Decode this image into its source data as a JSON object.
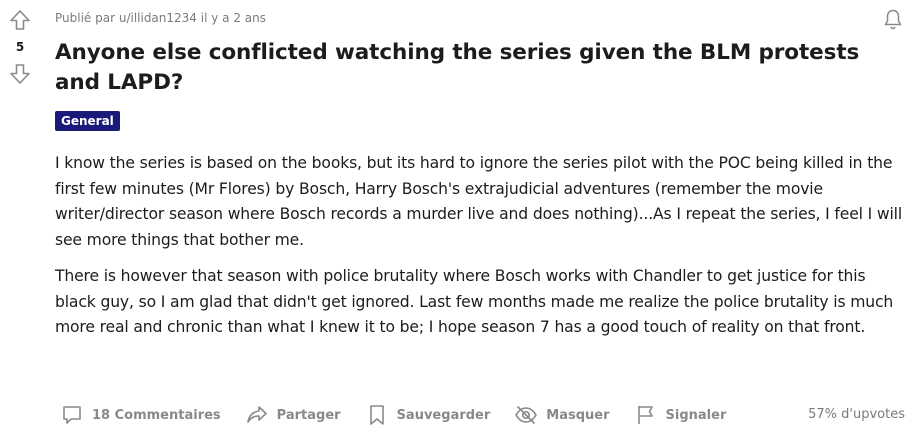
{
  "vote": {
    "score": "5"
  },
  "post": {
    "meta": "Publié par u/illidan1234 il y a 2 ans",
    "title": "Anyone else conflicted watching the series given the BLM protests and LAPD?",
    "flair": "General",
    "flair_color": "#1a1a7a",
    "paragraphs": [
      "I know the series is based on the books, but its hard to ignore the series pilot with the POC being killed in the first few minutes (Mr Flores) by Bosch, Harry Bosch's extrajudicial adventures (remember the movie writer/director season where Bosch records a murder live and does nothing)...As I repeat the series, I feel I will see more things that bother me.",
      "There is however that season with police brutality where Bosch works with Chandler to get justice for this black guy, so I am glad that didn't get ignored. Last few months made me realize the police brutality is much more real and chronic than what I knew it to be; I hope season 7 has a good touch of reality on that front."
    ]
  },
  "actions": {
    "comments": "18 Commentaires",
    "share": "Partager",
    "save": "Sauvegarder",
    "hide": "Masquer",
    "report": "Signaler",
    "upvote_ratio": "57% d'upvotes"
  },
  "icons": {
    "upvote": "arrow-up-icon",
    "downvote": "arrow-down-icon",
    "notification": "bell-icon",
    "comments": "comment-bubble-icon",
    "share": "share-arrow-icon",
    "save": "bookmark-icon",
    "hide": "eye-slash-icon",
    "report": "flag-icon"
  }
}
